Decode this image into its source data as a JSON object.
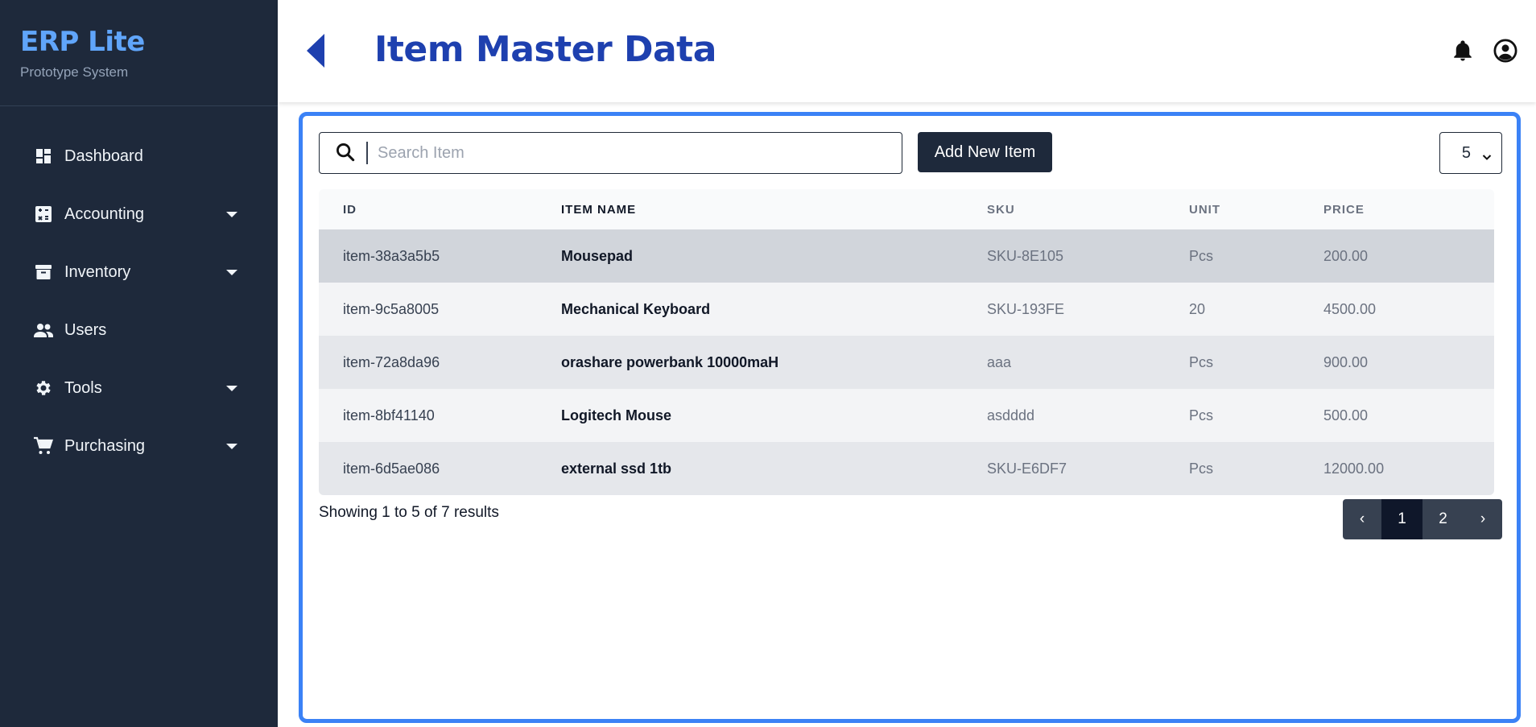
{
  "sidebar": {
    "brand_title": "ERP Lite",
    "brand_subtitle": "Prototype System",
    "items": [
      {
        "label": "Dashboard",
        "icon": "dashboard-icon",
        "has_submenu": false
      },
      {
        "label": "Accounting",
        "icon": "calculator-icon",
        "has_submenu": true
      },
      {
        "label": "Inventory",
        "icon": "archive-icon",
        "has_submenu": true
      },
      {
        "label": "Users",
        "icon": "users-icon",
        "has_submenu": false
      },
      {
        "label": "Tools",
        "icon": "gear-icon",
        "has_submenu": true
      },
      {
        "label": "Purchasing",
        "icon": "cart-icon",
        "has_submenu": true
      }
    ]
  },
  "header": {
    "title": "Item Master Data",
    "icons": [
      "bell-icon",
      "user-circle-icon"
    ]
  },
  "toolbar": {
    "search_placeholder": "Search Item",
    "search_value": "",
    "add_button_label": "Add New Item",
    "per_page_value": "5"
  },
  "table": {
    "columns": [
      "ID",
      "ITEM NAME",
      "SKU",
      "UNIT",
      "PRICE"
    ],
    "rows": [
      {
        "id": "item-38a3a5b5",
        "name": "Mousepad",
        "sku": "SKU-8E105",
        "unit": "Pcs",
        "price": "200.00"
      },
      {
        "id": "item-9c5a8005",
        "name": "Mechanical Keyboard",
        "sku": "SKU-193FE",
        "unit": "20",
        "price": "4500.00"
      },
      {
        "id": "item-72a8da96",
        "name": "orashare powerbank 10000maH",
        "sku": "aaa",
        "unit": "Pcs",
        "price": "900.00"
      },
      {
        "id": "item-8bf41140",
        "name": "Logitech Mouse",
        "sku": "asdddd",
        "unit": "Pcs",
        "price": "500.00"
      },
      {
        "id": "item-6d5ae086",
        "name": "external ssd 1tb",
        "sku": "SKU-E6DF7",
        "unit": "Pcs",
        "price": "12000.00"
      }
    ]
  },
  "footer": {
    "results_text": "Showing 1 to 5 of 7 results",
    "pager": {
      "prev": "‹",
      "pages": [
        "1",
        "2"
      ],
      "current": "1",
      "next": "›"
    }
  },
  "colors": {
    "sidebar_bg": "#1e293b",
    "brand_accent": "#60a5fa",
    "title_color": "#1e40af",
    "card_border": "#3b82f6"
  }
}
